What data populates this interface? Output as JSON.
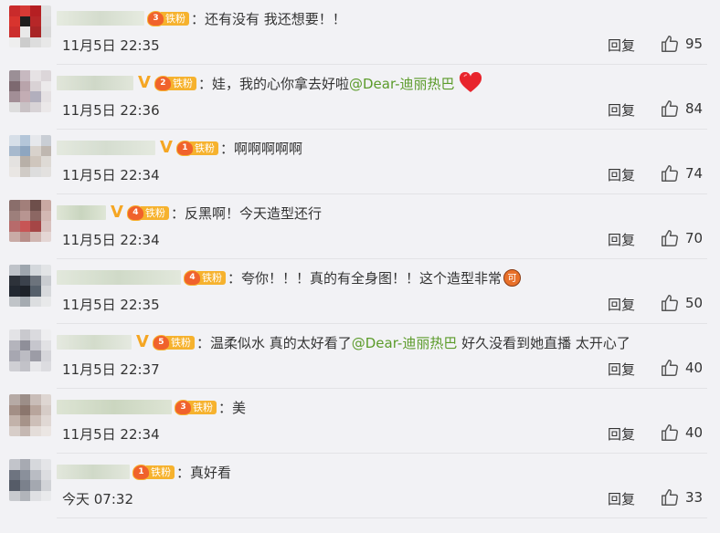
{
  "comments": [
    {
      "text": "还有没有 我还想要！！",
      "mention": "",
      "after": "",
      "time": "11月5日 22:35",
      "reply": "回复",
      "likes": "95",
      "fan_level": "3",
      "fan_tag": "铁粉",
      "verified": false,
      "emoji": ""
    },
    {
      "text": "娃，我的心你拿去好啦",
      "mention": "@Dear-迪丽热巴",
      "after": "",
      "time": "11月5日 22:36",
      "reply": "回复",
      "likes": "84",
      "fan_level": "2",
      "fan_tag": "铁粉",
      "verified": true,
      "emoji": "red-heart"
    },
    {
      "text": "啊啊啊啊啊",
      "mention": "",
      "after": "",
      "time": "11月5日 22:34",
      "reply": "回复",
      "likes": "74",
      "fan_level": "1",
      "fan_tag": "铁粉",
      "verified": true,
      "emoji": ""
    },
    {
      "text": "反黑啊！今天造型还行",
      "mention": "",
      "after": "",
      "time": "11月5日 22:34",
      "reply": "回复",
      "likes": "70",
      "fan_level": "4",
      "fan_tag": "铁粉",
      "verified": true,
      "emoji": ""
    },
    {
      "text": "夸你！！！真的有全身图！！这个造型非常",
      "mention": "",
      "after": "",
      "time": "11月5日 22:35",
      "reply": "回复",
      "likes": "50",
      "fan_level": "4",
      "fan_tag": "铁粉",
      "verified": false,
      "emoji": "ke"
    },
    {
      "text": "温柔似水 真的太好看了",
      "mention": "@Dear-迪丽热巴",
      "after": " 好久没看到她直播 太开心了",
      "time": "11月5日 22:37",
      "reply": "回复",
      "likes": "40",
      "fan_level": "5",
      "fan_tag": "铁粉",
      "verified": true,
      "emoji": ""
    },
    {
      "text": "美",
      "mention": "",
      "after": "",
      "time": "11月5日 22:34",
      "reply": "回复",
      "likes": "40",
      "fan_level": "3",
      "fan_tag": "铁粉",
      "verified": false,
      "emoji": ""
    },
    {
      "text": "真好看",
      "mention": "",
      "after": "",
      "time": "今天 07:32",
      "reply": "回复",
      "likes": "33",
      "fan_level": "1",
      "fan_tag": "铁粉",
      "verified": false,
      "emoji": ""
    }
  ],
  "emoji_labels": {
    "ke": "可"
  },
  "colors": {
    "mention": "#5b9b2a",
    "fan_badge": "#f6b22e",
    "verified": "#f5a623"
  },
  "icons": {
    "like": "thumbs-up-icon",
    "verified": "verified-v-icon",
    "fan": "fan-crown-badge-icon"
  }
}
